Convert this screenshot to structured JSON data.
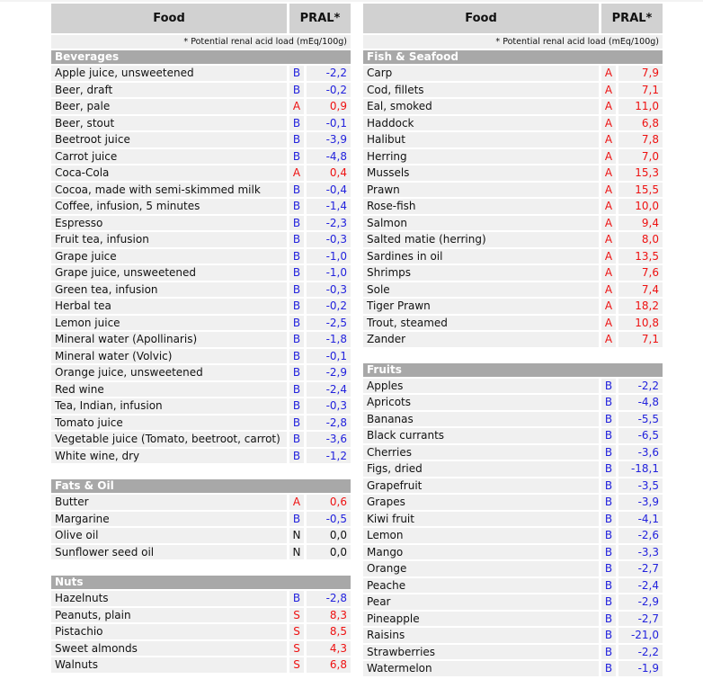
{
  "header": {
    "food_label": "Food",
    "pral_label": "PRAL*",
    "footnote": "* Potential renal acid load (mEq/100g)"
  },
  "colors": {
    "A": "#ee1111",
    "S": "#ee1111",
    "B": "#2222dd",
    "N": "#111111",
    "header_bg": "#d1d1d1",
    "category_bg": "#a8a8a8",
    "row_bg": "#f0f0f0"
  },
  "columns": {
    "left": [
      {
        "category": "Beverages",
        "items": [
          {
            "food": "Apple juice, unsweetened",
            "grade": "B",
            "pral": "-2,2"
          },
          {
            "food": "Beer, draft",
            "grade": "B",
            "pral": "-0,2"
          },
          {
            "food": "Beer, pale",
            "grade": "A",
            "pral": "0,9"
          },
          {
            "food": "Beer, stout",
            "grade": "B",
            "pral": "-0,1"
          },
          {
            "food": "Beetroot juice",
            "grade": "B",
            "pral": "-3,9"
          },
          {
            "food": "Carrot juice",
            "grade": "B",
            "pral": "-4,8"
          },
          {
            "food": "Coca-Cola",
            "grade": "A",
            "pral": "0,4"
          },
          {
            "food": "Cocoa, made with semi-skimmed milk",
            "grade": "B",
            "pral": "-0,4"
          },
          {
            "food": "Coffee, infusion, 5 minutes",
            "grade": "B",
            "pral": "-1,4"
          },
          {
            "food": "Espresso",
            "grade": "B",
            "pral": "-2,3"
          },
          {
            "food": "Fruit tea, infusion",
            "grade": "B",
            "pral": "-0,3"
          },
          {
            "food": "Grape juice",
            "grade": "B",
            "pral": "-1,0"
          },
          {
            "food": "Grape juice, unsweetened",
            "grade": "B",
            "pral": "-1,0"
          },
          {
            "food": "Green tea, infusion",
            "grade": "B",
            "pral": "-0,3"
          },
          {
            "food": "Herbal tea",
            "grade": "B",
            "pral": "-0,2"
          },
          {
            "food": "Lemon juice",
            "grade": "B",
            "pral": "-2,5"
          },
          {
            "food": "Mineral water (Apollinaris)",
            "grade": "B",
            "pral": "-1,8"
          },
          {
            "food": "Mineral water (Volvic)",
            "grade": "B",
            "pral": "-0,1"
          },
          {
            "food": "Orange juice, unsweetened",
            "grade": "B",
            "pral": "-2,9"
          },
          {
            "food": "Red wine",
            "grade": "B",
            "pral": "-2,4"
          },
          {
            "food": "Tea, Indian, infusion",
            "grade": "B",
            "pral": "-0,3"
          },
          {
            "food": "Tomato juice",
            "grade": "B",
            "pral": "-2,8"
          },
          {
            "food": "Vegetable juice (Tomato, beetroot, carrot)",
            "grade": "B",
            "pral": "-3,6"
          },
          {
            "food": "White wine, dry",
            "grade": "B",
            "pral": "-1,2"
          }
        ]
      },
      {
        "category": "Fats & Oil",
        "items": [
          {
            "food": "Butter",
            "grade": "A",
            "pral": "0,6"
          },
          {
            "food": "Margarine",
            "grade": "B",
            "pral": "-0,5"
          },
          {
            "food": "Olive oil",
            "grade": "N",
            "pral": "0,0"
          },
          {
            "food": "Sunflower seed oil",
            "grade": "N",
            "pral": "0,0"
          }
        ]
      },
      {
        "category": "Nuts",
        "items": [
          {
            "food": "Hazelnuts",
            "grade": "B",
            "pral": "-2,8"
          },
          {
            "food": "Peanuts, plain",
            "grade": "S",
            "pral": "8,3"
          },
          {
            "food": "Pistachio",
            "grade": "S",
            "pral": "8,5"
          },
          {
            "food": "Sweet almonds",
            "grade": "S",
            "pral": "4,3"
          },
          {
            "food": "Walnuts",
            "grade": "S",
            "pral": "6,8"
          }
        ]
      }
    ],
    "right": [
      {
        "category": "Fish & Seafood",
        "items": [
          {
            "food": "Carp",
            "grade": "A",
            "pral": "7,9"
          },
          {
            "food": "Cod, fillets",
            "grade": "A",
            "pral": "7,1"
          },
          {
            "food": "Eal, smoked",
            "grade": "A",
            "pral": "11,0"
          },
          {
            "food": "Haddock",
            "grade": "A",
            "pral": "6,8"
          },
          {
            "food": "Halibut",
            "grade": "A",
            "pral": "7,8"
          },
          {
            "food": "Herring",
            "grade": "A",
            "pral": "7,0"
          },
          {
            "food": "Mussels",
            "grade": "A",
            "pral": "15,3"
          },
          {
            "food": "Prawn",
            "grade": "A",
            "pral": "15,5"
          },
          {
            "food": "Rose-fish",
            "grade": "A",
            "pral": "10,0"
          },
          {
            "food": "Salmon",
            "grade": "A",
            "pral": "9,4"
          },
          {
            "food": "Salted matie (herring)",
            "grade": "A",
            "pral": "8,0"
          },
          {
            "food": "Sardines in oil",
            "grade": "A",
            "pral": "13,5"
          },
          {
            "food": "Shrimps",
            "grade": "A",
            "pral": "7,6"
          },
          {
            "food": "Sole",
            "grade": "A",
            "pral": "7,4"
          },
          {
            "food": "Tiger Prawn",
            "grade": "A",
            "pral": "18,2"
          },
          {
            "food": "Trout, steamed",
            "grade": "A",
            "pral": "10,8"
          },
          {
            "food": "Zander",
            "grade": "A",
            "pral": "7,1"
          }
        ]
      },
      {
        "category": "Fruits",
        "items": [
          {
            "food": "Apples",
            "grade": "B",
            "pral": "-2,2"
          },
          {
            "food": "Apricots",
            "grade": "B",
            "pral": "-4,8"
          },
          {
            "food": "Bananas",
            "grade": "B",
            "pral": "-5,5"
          },
          {
            "food": "Black currants",
            "grade": "B",
            "pral": "-6,5"
          },
          {
            "food": "Cherries",
            "grade": "B",
            "pral": "-3,6"
          },
          {
            "food": "Figs, dried",
            "grade": "B",
            "pral": "-18,1"
          },
          {
            "food": "Grapefruit",
            "grade": "B",
            "pral": "-3,5"
          },
          {
            "food": "Grapes",
            "grade": "B",
            "pral": "-3,9"
          },
          {
            "food": "Kiwi fruit",
            "grade": "B",
            "pral": "-4,1"
          },
          {
            "food": "Lemon",
            "grade": "B",
            "pral": "-2,6"
          },
          {
            "food": "Mango",
            "grade": "B",
            "pral": "-3,3"
          },
          {
            "food": "Orange",
            "grade": "B",
            "pral": "-2,7"
          },
          {
            "food": "Peache",
            "grade": "B",
            "pral": "-2,4"
          },
          {
            "food": "Pear",
            "grade": "B",
            "pral": "-2,9"
          },
          {
            "food": "Pineapple",
            "grade": "B",
            "pral": "-2,7"
          },
          {
            "food": "Raisins",
            "grade": "B",
            "pral": "-21,0"
          },
          {
            "food": "Strawberries",
            "grade": "B",
            "pral": "-2,2"
          },
          {
            "food": "Watermelon",
            "grade": "B",
            "pral": "-1,9"
          }
        ]
      }
    ]
  }
}
